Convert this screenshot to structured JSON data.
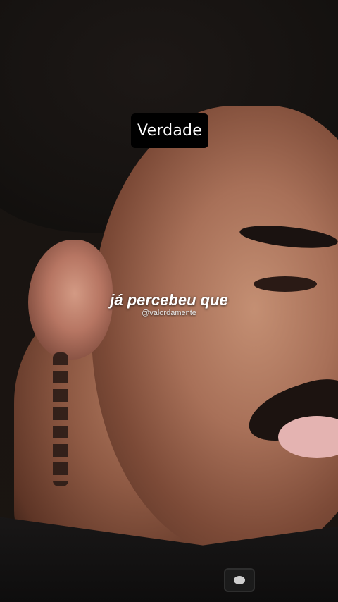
{
  "overlay": {
    "title_label": "Verdade",
    "caption_text": "já percebeu que",
    "watermark_text": "@valordamente"
  }
}
